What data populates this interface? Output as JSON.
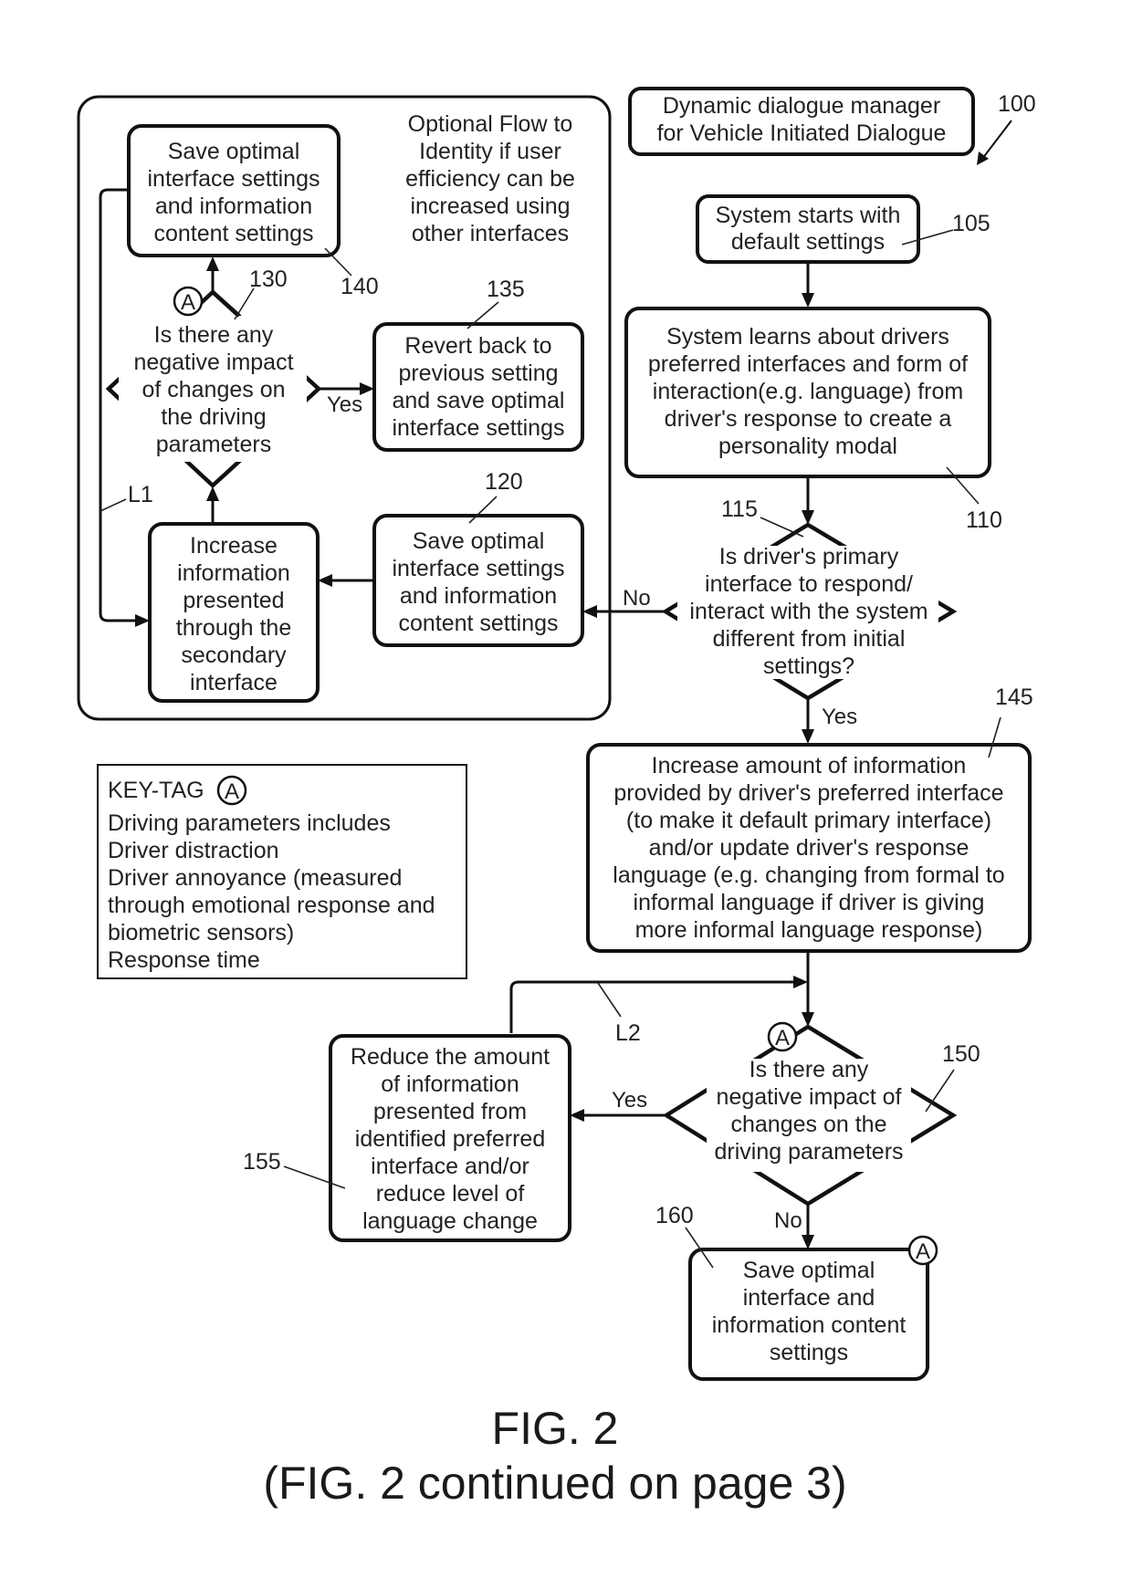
{
  "title_box": {
    "lines": [
      "Dynamic dialogue manager",
      "for Vehicle Initiated Dialogue"
    ],
    "ref": "100"
  },
  "optional_flow": {
    "caption": [
      "Optional Flow to",
      "Identity if user",
      "efficiency can be",
      "increased using",
      "other interfaces"
    ],
    "steps": {
      "s140": {
        "ref": "140",
        "lines": [
          "Save optimal",
          "interface settings",
          "and information",
          "content settings"
        ]
      },
      "s130": {
        "ref": "130",
        "lines": [
          "Is there any",
          "negative impact",
          "of changes on",
          "the driving",
          "parameters"
        ],
        "yes_label": "Yes"
      },
      "s135": {
        "ref": "135",
        "lines": [
          "Revert back to",
          "previous setting",
          "and save optimal",
          "interface settings"
        ]
      },
      "s120": {
        "ref": "120",
        "lines": [
          "Save optimal",
          "interface settings",
          "and information",
          "content settings"
        ]
      },
      "s125": {
        "lines": [
          "Increase",
          "information",
          "presented",
          "through the",
          "secondary",
          "interface"
        ]
      }
    },
    "loop_label": "L1"
  },
  "main_flow": {
    "s105": {
      "ref": "105",
      "lines": [
        "System starts with",
        "default settings"
      ]
    },
    "s110": {
      "ref": "110",
      "lines": [
        "System learns about drivers",
        "preferred interfaces and form of",
        "interaction(e.g. language) from",
        "driver's response to create a",
        "personality modal"
      ]
    },
    "s115": {
      "ref": "115",
      "lines": [
        "Is driver's primary",
        "interface to respond/",
        "interact with the system",
        "different from initial",
        "settings?"
      ],
      "no_label": "No",
      "yes_label": "Yes"
    },
    "s145": {
      "ref": "145",
      "lines": [
        "Increase amount of information",
        "provided by driver's preferred interface",
        "(to make it default primary interface)",
        "and/or update driver's response",
        "language (e.g. changing from formal to",
        "informal language if driver is giving",
        "more informal language response)"
      ]
    },
    "s150": {
      "ref": "150",
      "lines": [
        "Is there any",
        "negative impact of",
        "changes on the",
        "driving parameters"
      ],
      "yes_label": "Yes",
      "no_label": "No"
    },
    "s155": {
      "ref": "155",
      "lines": [
        "Reduce the amount",
        "of information",
        "presented from",
        "identified preferred",
        "interface and/or",
        "reduce level of",
        "language change"
      ]
    },
    "s160": {
      "ref": "160",
      "lines": [
        "Save optimal",
        "interface and",
        "information content",
        "settings"
      ]
    },
    "loop_label": "L2"
  },
  "key_tag": {
    "heading": "KEY-TAG",
    "symbol": "A",
    "lines": [
      "Driving parameters includes",
      "Driver distraction",
      "Driver annoyance (measured",
      "through emotional response and",
      "biometric sensors)",
      "Response time"
    ]
  },
  "tag_symbol": "A",
  "caption": {
    "line1": "FIG. 2",
    "line2": "(FIG. 2 continued on page 3)"
  }
}
